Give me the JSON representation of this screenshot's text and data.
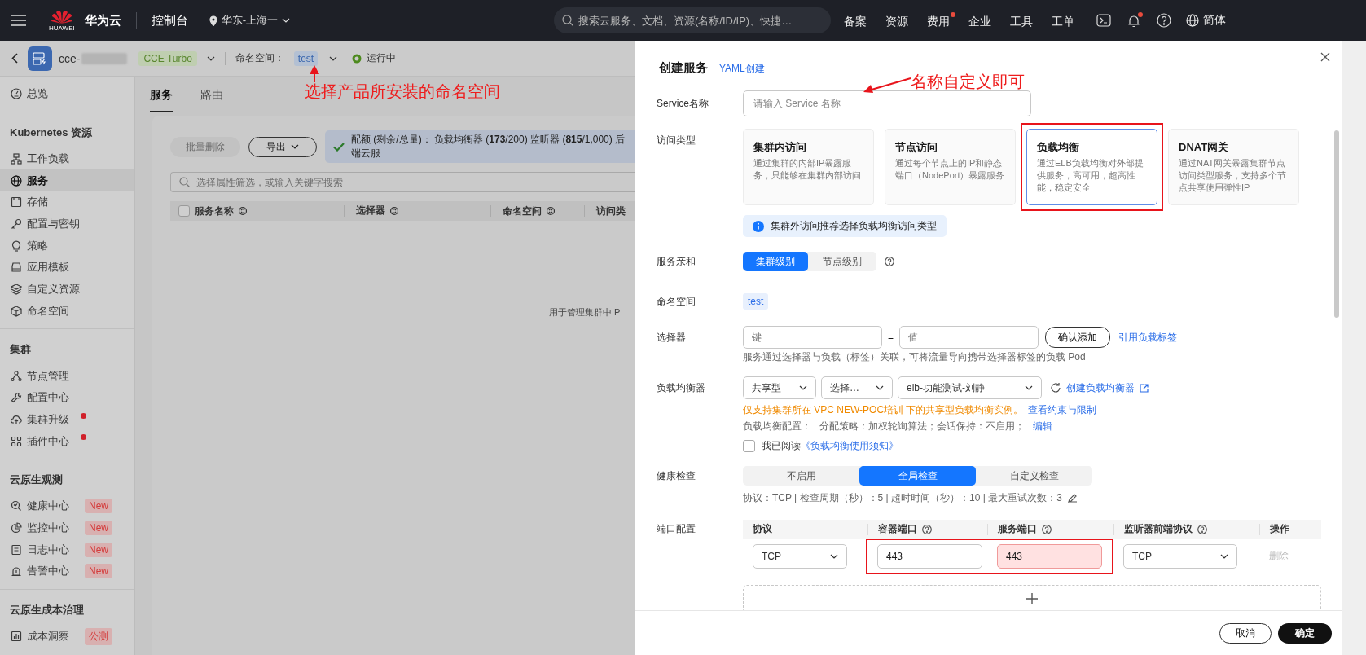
{
  "top_bar": {
    "logo_caption": "HUAWEI",
    "brand": "华为云",
    "console": "控制台",
    "region": "华东-上海一",
    "search": {
      "placeholder": "搜索云服务、文档、资源(名称/ID/IP)、快捷…"
    },
    "nav": [
      {
        "label": "备案",
        "dot": false
      },
      {
        "label": "资源",
        "dot": false
      },
      {
        "label": "费用",
        "dot": true
      },
      {
        "label": "企业",
        "dot": false
      },
      {
        "label": "工具",
        "dot": false
      },
      {
        "label": "工单",
        "dot": false
      }
    ],
    "bell_dot": true,
    "language": "简体"
  },
  "cluster_bar": {
    "name": "cce-",
    "edition": "CCE Turbo",
    "namespace_label": "命名空间：",
    "namespace": "test",
    "status": "运行中"
  },
  "sidebar": {
    "sections": [
      {
        "items": [
          {
            "label": "总览",
            "selected": false
          }
        ]
      },
      {
        "title": "Kubernetes 资源",
        "items": [
          {
            "label": "工作负载",
            "selected": false
          },
          {
            "label": "服务",
            "selected": true
          },
          {
            "label": "存储",
            "selected": false
          },
          {
            "label": "配置与密钥",
            "selected": false
          },
          {
            "label": "策略",
            "selected": false
          },
          {
            "label": "应用模板",
            "selected": false
          },
          {
            "label": "自定义资源",
            "selected": false
          },
          {
            "label": "命名空间",
            "selected": false
          }
        ]
      },
      {
        "title": "集群",
        "items": [
          {
            "label": "节点管理",
            "selected": false
          },
          {
            "label": "配置中心",
            "selected": false
          },
          {
            "label": "集群升级",
            "selected": false,
            "dot": true
          },
          {
            "label": "插件中心",
            "selected": false,
            "dot": true
          }
        ]
      },
      {
        "title": "云原生观测",
        "items": [
          {
            "label": "健康中心",
            "selected": false,
            "badge": "New"
          },
          {
            "label": "监控中心",
            "selected": false,
            "badge": "New"
          },
          {
            "label": "日志中心",
            "selected": false,
            "badge": "New"
          },
          {
            "label": "告警中心",
            "selected": false,
            "badge": "New"
          }
        ]
      },
      {
        "title": "云原生成本治理",
        "items": [
          {
            "label": "成本洞察",
            "selected": false,
            "badge": "公测"
          }
        ]
      }
    ]
  },
  "main": {
    "tabs": [
      {
        "label": "服务",
        "selected": true
      },
      {
        "label": "路由",
        "selected": false
      }
    ],
    "batch_delete": {
      "label": "批量删除",
      "disabled": true
    },
    "export": {
      "label": "导出"
    },
    "quota": "配额 (剩余/总量)： 负载均衡器 (**173**/200) 监听器 (**815**/1,000) 后端云服",
    "search": {
      "placeholder": "选择属性筛选，或输入关键字搜索"
    },
    "table": {
      "select_all_checked": false,
      "columns": [
        {
          "label": "服务名称",
          "sortable": true,
          "has_tooltip": false
        },
        {
          "label": "选择器",
          "sortable": true,
          "has_tooltip": true
        },
        {
          "label": "命名空间",
          "sortable": true,
          "has_tooltip": false
        },
        {
          "label": "访问类",
          "sortable": false,
          "has_tooltip": false
        }
      ],
      "empty_text": "用于管理集群中 P"
    }
  },
  "drawer": {
    "title": "创建服务",
    "yaml_link": "YAML创建",
    "service_name": {
      "label": "Service名称",
      "placeholder": "请输入 Service 名称"
    },
    "access_type": {
      "label": "访问类型",
      "options": [
        {
          "title": "集群内访问",
          "description": "通过集群的内部IP暴露服务，只能够在集群内部访问",
          "selected": false,
          "highlighted": false
        },
        {
          "title": "节点访问",
          "description": "通过每个节点上的IP和静态端口（NodePort）暴露服务",
          "selected": false,
          "highlighted": false
        },
        {
          "title": "负载均衡",
          "description": "通过ELB负载均衡对外部提供服务，高可用，超高性能，稳定安全",
          "selected": true,
          "highlighted": true
        },
        {
          "title": "DNAT网关",
          "description": "通过NAT网关暴露集群节点访问类型服务，支持多个节点共享使用弹性IP",
          "selected": false,
          "highlighted": false
        }
      ],
      "tip": "集群外访问推荐选择负载均衡访问类型"
    },
    "affinity": {
      "label": "服务亲和",
      "options": [
        {
          "label": "集群级别",
          "selected": true
        },
        {
          "label": "节点级别",
          "selected": false
        }
      ]
    },
    "namespace": {
      "label": "命名空间",
      "value": "test"
    },
    "selector": {
      "label": "选择器",
      "key_placeholder": "键",
      "equals": "=",
      "value_placeholder": "值",
      "add_button": "确认添加",
      "reference_link": "引用负载标签",
      "hint": "服务通过选择器与负载（标签）关联，可将流量导向携带选择器标签的负载 Pod"
    },
    "load_balancer": {
      "label": "负载均衡器",
      "selects": [
        "共享型",
        "选择…",
        "elb-功能测试-刘静"
      ],
      "create_link": "创建负载均衡器",
      "warning": "仅支持集群所在 VPC NEW-POC培训 下的共享型负载均衡实例。",
      "warning_link": "查看约束与限制",
      "config_label": "负载均衡配置：",
      "config_text": "分配策略：加权轮询算法；会话保持：不启用；",
      "edit_link": "编辑",
      "agreement": {
        "checked": false,
        "text": "我已阅读",
        "link": "《负载均衡使用须知》"
      }
    },
    "health_check": {
      "label": "健康检查",
      "options": [
        {
          "label": "不启用",
          "selected": false
        },
        {
          "label": "全局检查",
          "selected": true
        },
        {
          "label": "自定义检查",
          "selected": false
        }
      ],
      "summary": "协议：TCP | 检查周期（秒）：5 | 超时时间（秒）：10 | 最大重试次数：3"
    },
    "ports": {
      "label": "端口配置",
      "columns": [
        {
          "label": "协议",
          "help": false
        },
        {
          "label": "容器端口",
          "help": true
        },
        {
          "label": "服务端口",
          "help": true
        },
        {
          "label": "监听器前端协议",
          "help": true
        },
        {
          "label": "操作",
          "help": false
        }
      ],
      "rows": [
        {
          "protocol": "TCP",
          "container_port": "443",
          "service_port": "443",
          "service_port_error": true,
          "listener_protocol": "TCP",
          "delete": "删除",
          "delete_disabled": true,
          "highlighted": true
        }
      ]
    },
    "cancel": "取消",
    "confirm": "确定"
  },
  "annotations": [
    {
      "text": "选择产品所安装的命名空间"
    },
    {
      "text": "名称自定义即可"
    }
  ]
}
